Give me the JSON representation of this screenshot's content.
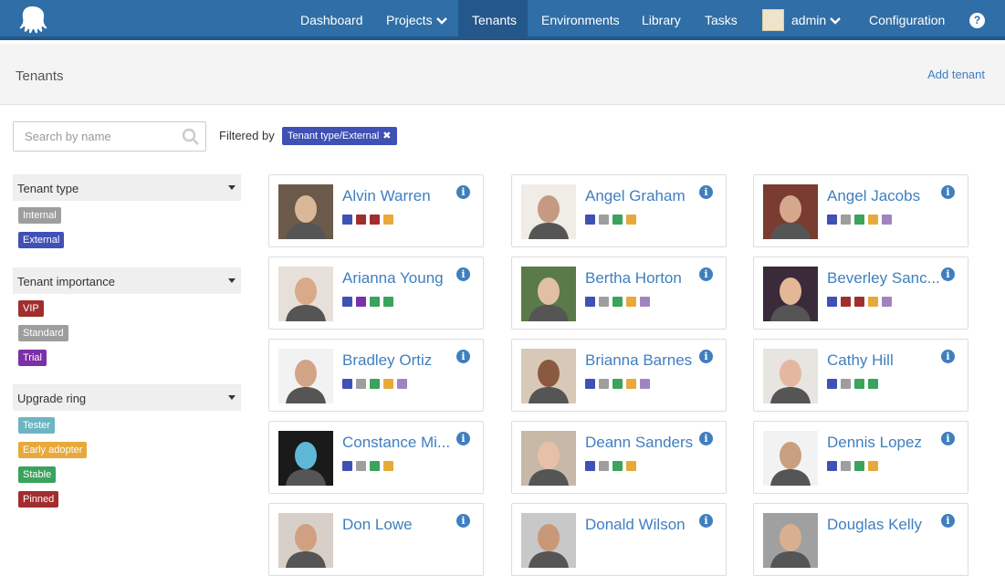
{
  "nav": {
    "items": [
      {
        "label": "Dashboard"
      },
      {
        "label": "Projects"
      },
      {
        "label": "Tenants"
      },
      {
        "label": "Environments"
      },
      {
        "label": "Library"
      },
      {
        "label": "Tasks"
      },
      {
        "label": "admin"
      },
      {
        "label": "Configuration"
      }
    ],
    "help": "?"
  },
  "header": {
    "title": "Tenants",
    "add_label": "Add tenant"
  },
  "search": {
    "placeholder": "Search by name",
    "value": ""
  },
  "filter": {
    "label": "Filtered by",
    "chip": "Tenant type/External",
    "chip_close": "✖"
  },
  "colors": {
    "nav_bg": "#2f6ea6",
    "link": "#3f7fbf",
    "external": "#3f51b5",
    "internal": "#9e9e9e",
    "vip": "#a12e2e",
    "standard": "#9e9e9e",
    "trial": "#7b2fa8",
    "tester": "#6bb6c2",
    "early_adopter": "#e8a93b",
    "stable": "#3aa35c",
    "pinned": "#a12e2e",
    "purple_light": "#a084c0"
  },
  "groups": [
    {
      "title": "Tenant type",
      "tags": [
        {
          "label": "Internal",
          "color": "#9e9e9e"
        },
        {
          "label": "External",
          "color": "#3f51b5"
        }
      ]
    },
    {
      "title": "Tenant importance",
      "tags": [
        {
          "label": "VIP",
          "color": "#a12e2e"
        },
        {
          "label": "Standard",
          "color": "#9e9e9e"
        },
        {
          "label": "Trial",
          "color": "#7b2fa8"
        }
      ]
    },
    {
      "title": "Upgrade ring",
      "tags": [
        {
          "label": "Tester",
          "color": "#6bb6c2"
        },
        {
          "label": "Early adopter",
          "color": "#e8a93b"
        },
        {
          "label": "Stable",
          "color": "#3aa35c"
        },
        {
          "label": "Pinned",
          "color": "#a12e2e"
        }
      ]
    }
  ],
  "tenants": [
    {
      "name": "Alvin Warren",
      "tags": [
        "#3f51b5",
        "#a12e2e",
        "#a12e2e",
        "#e8a93b"
      ]
    },
    {
      "name": "Angel Graham",
      "tags": [
        "#3f51b5",
        "#9e9e9e",
        "#3aa35c",
        "#e8a93b"
      ]
    },
    {
      "name": "Angel Jacobs",
      "tags": [
        "#3f51b5",
        "#9e9e9e",
        "#3aa35c",
        "#e8a93b",
        "#a084c0"
      ]
    },
    {
      "name": "Arianna Young",
      "tags": [
        "#3f51b5",
        "#7b2fa8",
        "#3aa35c",
        "#3aa35c"
      ]
    },
    {
      "name": "Bertha Horton",
      "tags": [
        "#3f51b5",
        "#9e9e9e",
        "#3aa35c",
        "#e8a93b",
        "#a084c0"
      ]
    },
    {
      "name": "Beverley Sanc...",
      "tags": [
        "#3f51b5",
        "#a12e2e",
        "#a12e2e",
        "#e8a93b",
        "#a084c0"
      ]
    },
    {
      "name": "Bradley Ortiz",
      "tags": [
        "#3f51b5",
        "#9e9e9e",
        "#3aa35c",
        "#e8a93b",
        "#a084c0"
      ]
    },
    {
      "name": "Brianna Barnes",
      "tags": [
        "#3f51b5",
        "#9e9e9e",
        "#3aa35c",
        "#e8a93b",
        "#a084c0"
      ]
    },
    {
      "name": "Cathy Hill",
      "tags": [
        "#3f51b5",
        "#9e9e9e",
        "#3aa35c",
        "#3aa35c"
      ]
    },
    {
      "name": "Constance Mi...",
      "tags": [
        "#3f51b5",
        "#9e9e9e",
        "#3aa35c",
        "#e8a93b"
      ]
    },
    {
      "name": "Deann Sanders",
      "tags": [
        "#3f51b5",
        "#9e9e9e",
        "#3aa35c",
        "#e8a93b"
      ]
    },
    {
      "name": "Dennis Lopez",
      "tags": [
        "#3f51b5",
        "#9e9e9e",
        "#3aa35c",
        "#e8a93b"
      ]
    },
    {
      "name": "Don Lowe",
      "tags": []
    },
    {
      "name": "Donald Wilson",
      "tags": []
    },
    {
      "name": "Douglas Kelly",
      "tags": []
    }
  ]
}
